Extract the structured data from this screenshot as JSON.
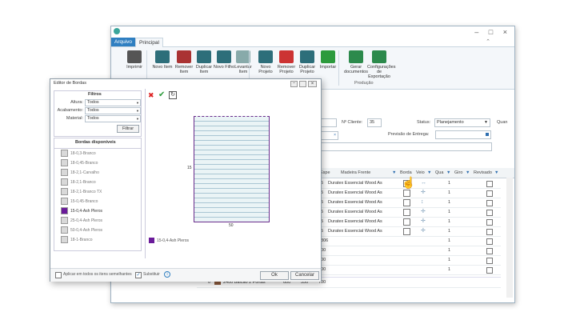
{
  "main_window": {
    "menu": {
      "file": "Arquivo",
      "main": "Principal"
    },
    "ribbon": {
      "buttons": [
        {
          "label": "Imprimir",
          "icon": "printer-icon"
        },
        {
          "label": "Novo Item",
          "icon": "new-item-icon"
        },
        {
          "label": "Remover Item",
          "icon": "remove-item-icon"
        },
        {
          "label": "Duplicar Item",
          "icon": "duplicate-item-icon"
        },
        {
          "label": "Novo Filho",
          "icon": "new-child-icon"
        },
        {
          "label": "Levantar Item",
          "icon": "raise-item-icon"
        },
        {
          "label": "Novo Projeto",
          "icon": "new-project-icon"
        },
        {
          "label": "Remover Projeto",
          "icon": "remove-project-icon"
        },
        {
          "label": "Duplicar Projeto",
          "icon": "duplicate-project-icon"
        },
        {
          "label": "Importar",
          "icon": "import-icon"
        },
        {
          "label": "Gerar documentos",
          "icon": "generate-docs-icon"
        },
        {
          "label": "Configurações de Exportação",
          "icon": "export-settings-icon"
        }
      ],
      "group_label": "Produção"
    },
    "form": {
      "client_no_label": "Nº Cliente:",
      "client_no_value": "35",
      "status_label": "Status:",
      "status_value": "Planejamento",
      "quantity_label": "Quan",
      "delivery_label": "Previsão de Entrega:"
    },
    "grid": {
      "headers": [
        "Espe",
        "Madeira Frente",
        "Borda",
        "Veio",
        "Qua",
        "Giro",
        "Revisado"
      ],
      "rows": [
        {
          "thick": "15",
          "material": "Duratex Essencial Wood As",
          "qty": "1"
        },
        {
          "thick": "15",
          "material": "Duratex Essencial Wood As",
          "qty": "1"
        },
        {
          "thick": "15",
          "material": "Duratex Essencial Wood As",
          "qty": "1"
        },
        {
          "thick": "15",
          "material": "Duratex Essencial Wood As",
          "qty": "1"
        },
        {
          "thick": "15",
          "material": "Duratex Essencial Wood As",
          "qty": "1"
        },
        {
          "thick": "15",
          "material": "Duratex Essencial Wood As",
          "qty": "1"
        },
        {
          "thick": "1806",
          "material": "",
          "qty": "1"
        },
        {
          "thick": "400",
          "material": "",
          "qty": "1"
        },
        {
          "thick": "700",
          "material": "",
          "qty": "1"
        },
        {
          "thick": "700",
          "material": "",
          "qty": "1"
        }
      ],
      "bottom_row": {
        "num": "0",
        "name": "2400 Balcão 2 Portas",
        "c1": "600",
        "c2": "550",
        "c3": "700"
      }
    }
  },
  "dialog": {
    "title": "Editor de Bordas",
    "filters_title": "Filtros",
    "filter_labels": [
      "Altura:",
      "Acabamento:",
      "Material:"
    ],
    "filter_values": [
      "Todos",
      "Todos",
      "Todos"
    ],
    "filter_button": "Filtrar",
    "available_title": "Bordas disponíveis",
    "edges": [
      {
        "label": "18-0,3-Branco",
        "color": "#d9d9d9"
      },
      {
        "label": "18-0,45-Branco",
        "color": "#d9d9d9"
      },
      {
        "label": "18-2,1-Carvalho",
        "color": "#d9d9d9"
      },
      {
        "label": "18-2,1-Branco",
        "color": "#d9d9d9"
      },
      {
        "label": "18-2,1-Branco TX",
        "color": "#d9d9d9"
      },
      {
        "label": "15-0,45-Branco",
        "color": "#d9d9d9"
      },
      {
        "label": "15-0,4-Ash Pleros",
        "color": "#6a1b9a",
        "selected": true
      },
      {
        "label": "25-0,4-Ash Pleros",
        "color": "#d9d9d9"
      },
      {
        "label": "50-0,4-Ash Pleros",
        "color": "#d9d9d9"
      },
      {
        "label": "18-1-Branco",
        "color": "#d9d9d9"
      }
    ],
    "apply_all_label": "Aplicar em todos os itens semelhantes",
    "substitute_label": "Substituir",
    "ok_label": "Ok",
    "cancel_label": "Cancelar",
    "dim_width": "50",
    "dim_height": "15",
    "legend_label": "15-0,4-Ash Pleros",
    "legend_color": "#6a1b9a"
  }
}
